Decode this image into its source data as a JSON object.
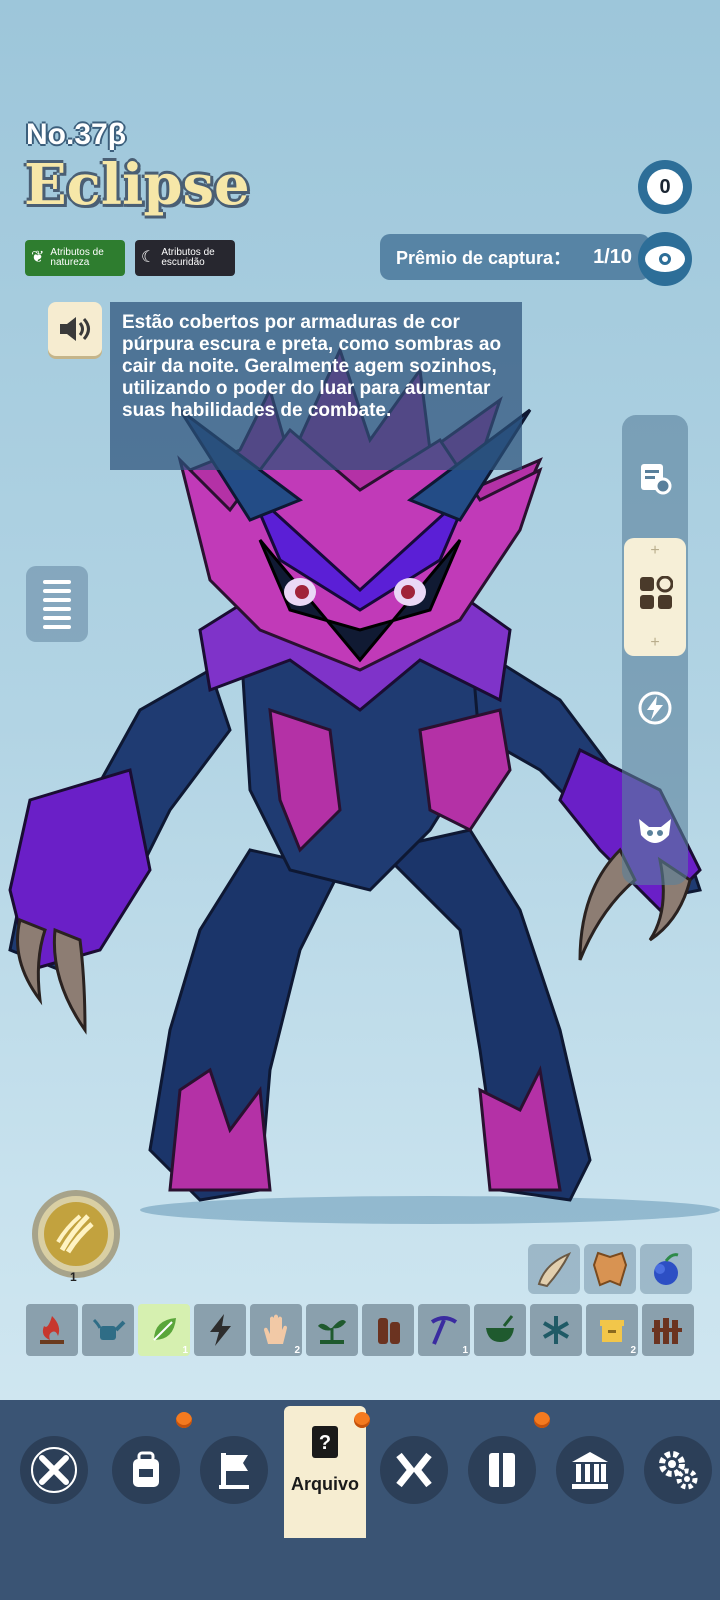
{
  "creature": {
    "number": "No.37β",
    "name": "Eclipse",
    "attributes": [
      {
        "label": "Atributos de natureza",
        "icon": "leaf-icon",
        "color": "#2e7d2f"
      },
      {
        "label": "Atributos de escuridão",
        "icon": "moon-icon",
        "color": "#27272f"
      }
    ],
    "description": "Estão cobertos por armaduras de cor púrpura escura e preta, como sombras ao cair da noite. Geralmente agem sozinhos, utilizando o poder do luar para aumentar suas habilidades de combate."
  },
  "hearts": "0",
  "capture": {
    "label": "Prêmio de captura：",
    "value": "1/10"
  },
  "side_panel": [
    "notes-gear-icon",
    "grid-icon",
    "lightning-icon",
    "creature-face-icon"
  ],
  "skill": {
    "icon": "claw-icon",
    "level": "1"
  },
  "drops": [
    "horn-icon",
    "leather-icon",
    "blue-fruit-icon"
  ],
  "work_suitability": [
    {
      "icon": "fire-icon",
      "count": ""
    },
    {
      "icon": "watering-icon",
      "count": ""
    },
    {
      "icon": "leaf-plant-icon",
      "count": "1"
    },
    {
      "icon": "electric-icon",
      "count": ""
    },
    {
      "icon": "hand-icon",
      "count": "2"
    },
    {
      "icon": "sprout-icon",
      "count": ""
    },
    {
      "icon": "lumber-icon",
      "count": ""
    },
    {
      "icon": "pickaxe-icon",
      "count": "1"
    },
    {
      "icon": "medicine-bowl-icon",
      "count": ""
    },
    {
      "icon": "snowflake-icon",
      "count": ""
    },
    {
      "icon": "box-icon",
      "count": "2"
    },
    {
      "icon": "fence-icon",
      "count": ""
    }
  ],
  "nav": {
    "active_label": "Arquivo",
    "items": [
      "close-icon",
      "backpack-icon",
      "flag-icon",
      "archive-icon",
      "tech-icon",
      "book-icon",
      "museum-icon",
      "settings-icon"
    ]
  },
  "colors": {
    "accent": "#2d6e98",
    "bar": "#3a5474",
    "notification": "#f47a1f"
  }
}
